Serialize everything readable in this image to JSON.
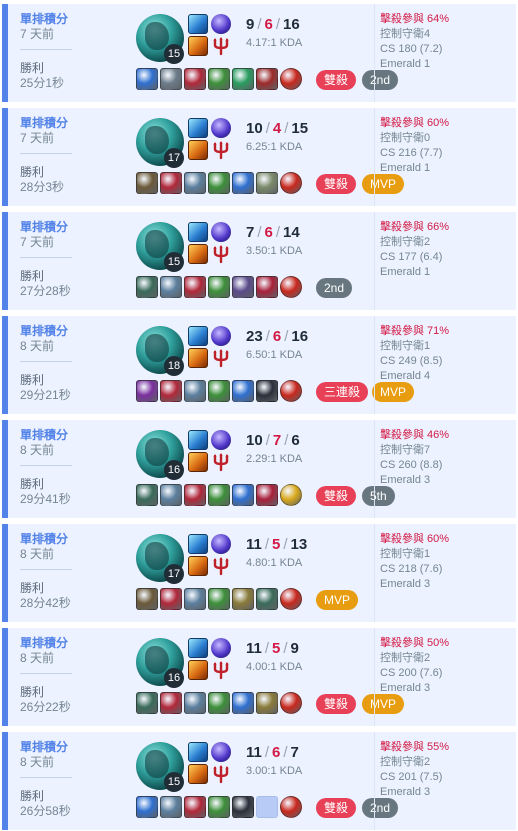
{
  "colors": {
    "win_accent": "#5383e8",
    "card_bg": "#ecf2ff",
    "death_red": "#d31a45",
    "badge_multikill": "#e84057",
    "badge_mvp": "#e89c0f",
    "badge_rank": "#68777f"
  },
  "icons": {
    "champion": "champion-portrait-icon",
    "spell_top": "flash-spell-icon",
    "spell_bottom": "smite-spell-icon",
    "rune_main": "keystone-rune-icon",
    "rune_sub": "trident-rune-tree-icon"
  },
  "matches": [
    {
      "queue": "單排積分",
      "ago": "7 天前",
      "result": "勝利",
      "duration": "25分1秒",
      "level": "15",
      "kills": "9",
      "deaths": "6",
      "assists": "16",
      "kda": "4.17:1 KDA",
      "items": [
        {
          "name": "item-blue-icon",
          "color": "#2f6fd0"
        },
        {
          "name": "item-blade-icon",
          "color": "#6c7c8a"
        },
        {
          "name": "item-red-icon",
          "color": "#b0283a"
        },
        {
          "name": "item-green-icon",
          "color": "#3d8f3a"
        },
        {
          "name": "item-greaves-icon",
          "color": "#2a9c5f"
        },
        {
          "name": "item-cleaver-icon",
          "color": "#9b2a2a"
        },
        {
          "name": "ward-icon",
          "color": "#c8281e"
        }
      ],
      "badges": [
        {
          "text": "雙殺",
          "type": "red"
        },
        {
          "text": "2nd",
          "type": "gray"
        }
      ],
      "kill_participation": "擊殺參與 64%",
      "control_wards": "控制守衛4",
      "cs": "CS 180 (7.2)",
      "rank": "Emerald 1"
    },
    {
      "queue": "單排積分",
      "ago": "7 天前",
      "result": "勝利",
      "duration": "28分3秒",
      "level": "17",
      "kills": "10",
      "deaths": "4",
      "assists": "15",
      "kda": "6.25:1 KDA",
      "items": [
        {
          "name": "item-armor-icon",
          "color": "#6b5a3a"
        },
        {
          "name": "item-red-icon",
          "color": "#b0283a"
        },
        {
          "name": "item-lance-icon",
          "color": "#5c7f9e"
        },
        {
          "name": "item-green-icon",
          "color": "#3d8f3a"
        },
        {
          "name": "item-blue-icon",
          "color": "#2f6fd0"
        },
        {
          "name": "item-sword-icon",
          "color": "#7a8a6a"
        },
        {
          "name": "ward-icon",
          "color": "#c8281e"
        }
      ],
      "badges": [
        {
          "text": "雙殺",
          "type": "red"
        },
        {
          "text": "MVP",
          "type": "orange"
        }
      ],
      "kill_participation": "擊殺參與 60%",
      "control_wards": "控制守衛0",
      "cs": "CS 216 (7.7)",
      "rank": "Emerald 1"
    },
    {
      "queue": "單排積分",
      "ago": "7 天前",
      "result": "勝利",
      "duration": "27分28秒",
      "level": "15",
      "kills": "7",
      "deaths": "6",
      "assists": "14",
      "kda": "3.50:1 KDA",
      "items": [
        {
          "name": "item-hydra-icon",
          "color": "#3a6b5a"
        },
        {
          "name": "item-lance-icon",
          "color": "#5c7f9e"
        },
        {
          "name": "item-red-icon",
          "color": "#b0283a"
        },
        {
          "name": "item-green-icon",
          "color": "#3d8f3a"
        },
        {
          "name": "item-axe-icon",
          "color": "#5a4a8a"
        },
        {
          "name": "item-crimson-icon",
          "color": "#a8203a"
        },
        {
          "name": "ward-icon",
          "color": "#c8281e"
        }
      ],
      "badges": [
        {
          "text": "2nd",
          "type": "gray"
        }
      ],
      "kill_participation": "擊殺參與 66%",
      "control_wards": "控制守衛2",
      "cs": "CS 177 (6.4)",
      "rank": "Emerald 1"
    },
    {
      "queue": "單排積分",
      "ago": "8 天前",
      "result": "勝利",
      "duration": "29分21秒",
      "level": "18",
      "kills": "23",
      "deaths": "6",
      "assists": "16",
      "kda": "6.50:1 KDA",
      "items": [
        {
          "name": "item-purple-icon",
          "color": "#7a2f9e"
        },
        {
          "name": "item-red-icon",
          "color": "#b0283a"
        },
        {
          "name": "item-lance-icon",
          "color": "#5c7f9e"
        },
        {
          "name": "item-green-icon",
          "color": "#3d8f3a"
        },
        {
          "name": "item-blue-icon",
          "color": "#2f6fd0"
        },
        {
          "name": "item-dark-icon",
          "color": "#2a2f3a"
        },
        {
          "name": "ward-icon",
          "color": "#c8281e"
        }
      ],
      "badges": [
        {
          "text": "三連殺",
          "type": "red"
        },
        {
          "text": "MVP",
          "type": "orange"
        }
      ],
      "kill_participation": "擊殺參與 71%",
      "control_wards": "控制守衛1",
      "cs": "CS 249 (8.5)",
      "rank": "Emerald 4"
    },
    {
      "queue": "單排積分",
      "ago": "8 天前",
      "result": "勝利",
      "duration": "29分41秒",
      "level": "16",
      "kills": "10",
      "deaths": "7",
      "assists": "6",
      "kda": "2.29:1 KDA",
      "items": [
        {
          "name": "item-hydra-icon",
          "color": "#3a6b5a"
        },
        {
          "name": "item-lance-icon",
          "color": "#5c7f9e"
        },
        {
          "name": "item-red-icon",
          "color": "#b0283a"
        },
        {
          "name": "item-green-icon",
          "color": "#3d8f3a"
        },
        {
          "name": "item-blue-icon",
          "color": "#2f6fd0"
        },
        {
          "name": "item-crimson-icon",
          "color": "#a8203a"
        },
        {
          "name": "yellow-trinket-icon",
          "color": "#d9a81c"
        }
      ],
      "badges": [
        {
          "text": "雙殺",
          "type": "red"
        },
        {
          "text": "5th",
          "type": "gray"
        }
      ],
      "kill_participation": "擊殺參與 46%",
      "control_wards": "控制守衛7",
      "cs": "CS 260 (8.8)",
      "rank": "Emerald 3"
    },
    {
      "queue": "單排積分",
      "ago": "8 天前",
      "result": "勝利",
      "duration": "28分42秒",
      "level": "17",
      "kills": "11",
      "deaths": "5",
      "assists": "13",
      "kda": "4.80:1 KDA",
      "items": [
        {
          "name": "item-armor-icon",
          "color": "#6b5a3a"
        },
        {
          "name": "item-red-icon",
          "color": "#b0283a"
        },
        {
          "name": "item-lance-icon",
          "color": "#5c7f9e"
        },
        {
          "name": "item-green-icon",
          "color": "#3d8f3a"
        },
        {
          "name": "item-gold-icon",
          "color": "#8a7a3a"
        },
        {
          "name": "item-hydra-icon",
          "color": "#3a6b5a"
        },
        {
          "name": "ward-icon",
          "color": "#c8281e"
        }
      ],
      "badges": [
        {
          "text": "MVP",
          "type": "orange"
        }
      ],
      "kill_participation": "擊殺參與 60%",
      "control_wards": "控制守衛1",
      "cs": "CS 218 (7.6)",
      "rank": "Emerald 3"
    },
    {
      "queue": "單排積分",
      "ago": "8 天前",
      "result": "勝利",
      "duration": "26分22秒",
      "level": "16",
      "kills": "11",
      "deaths": "5",
      "assists": "9",
      "kda": "4.00:1 KDA",
      "items": [
        {
          "name": "item-hydra-icon",
          "color": "#3a6b5a"
        },
        {
          "name": "item-red-icon",
          "color": "#b0283a"
        },
        {
          "name": "item-lance-icon",
          "color": "#5c7f9e"
        },
        {
          "name": "item-green-icon",
          "color": "#3d8f3a"
        },
        {
          "name": "item-blue-icon",
          "color": "#2f6fd0"
        },
        {
          "name": "item-gold-icon",
          "color": "#8a7a3a"
        },
        {
          "name": "ward-icon",
          "color": "#c8281e"
        }
      ],
      "badges": [
        {
          "text": "雙殺",
          "type": "red"
        },
        {
          "text": "MVP",
          "type": "orange"
        }
      ],
      "kill_participation": "擊殺參與 50%",
      "control_wards": "控制守衛2",
      "cs": "CS 200 (7.6)",
      "rank": "Emerald 3"
    },
    {
      "queue": "單排積分",
      "ago": "8 天前",
      "result": "勝利",
      "duration": "26分58秒",
      "level": "15",
      "kills": "11",
      "deaths": "6",
      "assists": "7",
      "kda": "3.00:1 KDA",
      "items": [
        {
          "name": "item-blue-icon",
          "color": "#2f6fd0"
        },
        {
          "name": "item-lance-icon",
          "color": "#5c7f9e"
        },
        {
          "name": "item-red-icon",
          "color": "#b0283a"
        },
        {
          "name": "item-green-icon",
          "color": "#3d8f3a"
        },
        {
          "name": "item-dark-icon",
          "color": "#2a2f3a"
        },
        {
          "name": "empty-item-slot",
          "color": ""
        },
        {
          "name": "ward-icon",
          "color": "#c8281e"
        }
      ],
      "badges": [
        {
          "text": "雙殺",
          "type": "red"
        },
        {
          "text": "2nd",
          "type": "gray"
        }
      ],
      "kill_participation": "擊殺參與 55%",
      "control_wards": "控制守衛2",
      "cs": "CS 201 (7.5)",
      "rank": "Emerald 3"
    }
  ]
}
